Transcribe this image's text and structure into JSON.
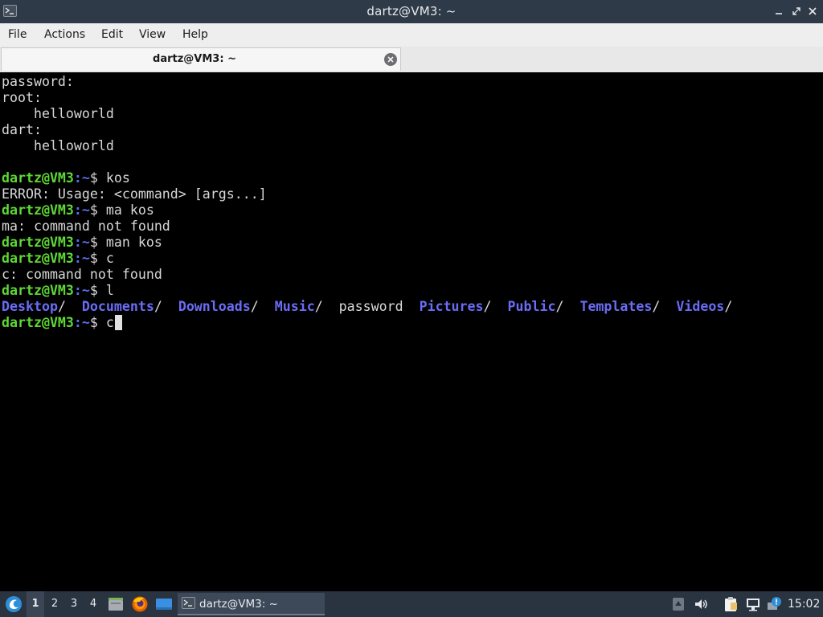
{
  "window": {
    "title": "dartz@VM3: ~",
    "icon": "terminal-icon",
    "controls": [
      "minimize-icon",
      "maximize-icon",
      "close-icon"
    ]
  },
  "menu": {
    "items": [
      "File",
      "Actions",
      "Edit",
      "View",
      "Help"
    ]
  },
  "tabs": [
    {
      "label": "dartz@VM3: ~",
      "active": true
    }
  ],
  "terminal": {
    "prompt_user": "dartz@VM3",
    "prompt_path": ":~",
    "prompt_symbol": "$ ",
    "lines": [
      "password:",
      "root:",
      "    helloworld",
      "dart:",
      "    helloworld",
      "",
      "kos",
      "ERROR: Usage: <command> [args...]",
      "ma kos",
      "ma: command not found",
      "man kos",
      "c",
      "c: command not found",
      "l",
      "",
      "c"
    ],
    "ls_output": [
      {
        "name": "Desktop",
        "is_dir": true
      },
      {
        "name": "Documents",
        "is_dir": true
      },
      {
        "name": "Downloads",
        "is_dir": true
      },
      {
        "name": "Music",
        "is_dir": true
      },
      {
        "name": "password",
        "is_dir": false
      },
      {
        "name": "Pictures",
        "is_dir": true
      },
      {
        "name": "Public",
        "is_dir": true
      },
      {
        "name": "Templates",
        "is_dir": true
      },
      {
        "name": "Videos",
        "is_dir": true
      }
    ]
  },
  "taskbar": {
    "start_icon": "lxqt-start-icon",
    "workspaces": [
      "1",
      "2",
      "3",
      "4"
    ],
    "active_workspace": "1",
    "launchers": [
      "file-manager-icon",
      "firefox-icon",
      "desktop-icon"
    ],
    "task_label": "dartz@VM3: ~",
    "tray_icons": [
      "scroll-up-icon",
      "volume-icon",
      "clipboard-icon",
      "network-icon",
      "update-notifier-icon"
    ],
    "clock": "15:02"
  },
  "colors": {
    "prompt_user": "#5fd735",
    "prompt_path": "#5c6cf0",
    "directory": "#6a6cf5",
    "terminal_bg": "#000000",
    "titlebar_bg": "#2e3a47",
    "taskbar_bg": "#2a3440"
  }
}
